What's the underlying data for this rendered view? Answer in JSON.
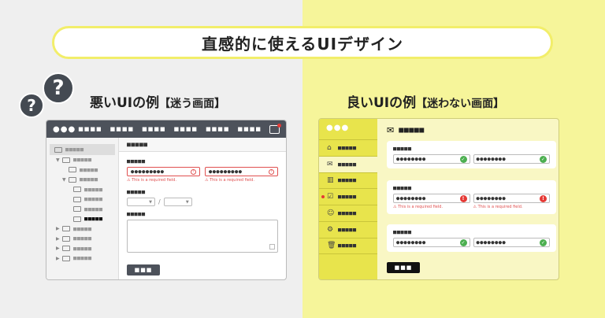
{
  "headline": "直感的に使えるUIデザイン",
  "left": {
    "bubble_big": "?",
    "bubble_small": "?",
    "label_main": "悪いUIの例",
    "label_sub": "【迷う画面】",
    "window": {
      "logo": "●●●",
      "menu": [
        "■■■■",
        "■■■■",
        "■■■■",
        "■■■■",
        "■■■■",
        "■■■■"
      ],
      "tree_root": "■■■■■",
      "tree": [
        "■■■■■",
        "■■■■■",
        "■■■■■",
        "■■■■■",
        "■■■■■",
        "■■■■■",
        "■■■■■",
        "■■■■■",
        "■■■■■",
        "■■■■■",
        "■■■■■"
      ],
      "header": "■■■■■",
      "field1_label": "■■■■■",
      "field1_value_a": "●●●●●●●●●",
      "field1_value_b": "●●●●●●●●●",
      "error_text": "⚠ This is a required field.",
      "field2_label": "■■■■■",
      "select_sep": "/",
      "field3_label": "■■■■■",
      "button": "■■■"
    }
  },
  "right": {
    "label_main": "良いUIの例",
    "label_sub": "【迷わない画面】",
    "window": {
      "logo": "●●●",
      "side_icons": [
        "⌂",
        "✉",
        "▥",
        "☑",
        "☺",
        "⚙",
        "🗑"
      ],
      "side_items": [
        "■■■■■",
        "■■■■■",
        "■■■■■",
        "■■■■■",
        "■■■■■",
        "■■■■■",
        "■■■■■"
      ],
      "header": "■■■■■",
      "card1_label": "■■■■■",
      "card2_label": "■■■■■",
      "card3_label": "■■■■■",
      "value": "●●●●●●●●",
      "error_text": "⚠ This is a required field.",
      "check": "✓",
      "bang": "!",
      "button": "■■■"
    }
  },
  "colors": {
    "left_bg": "#efefef",
    "right_bg": "#f6f59a",
    "accent_yellow": "#e8e44c",
    "error_red": "#e53935",
    "ok_green": "#4caf50",
    "dark": "#4d525b"
  }
}
